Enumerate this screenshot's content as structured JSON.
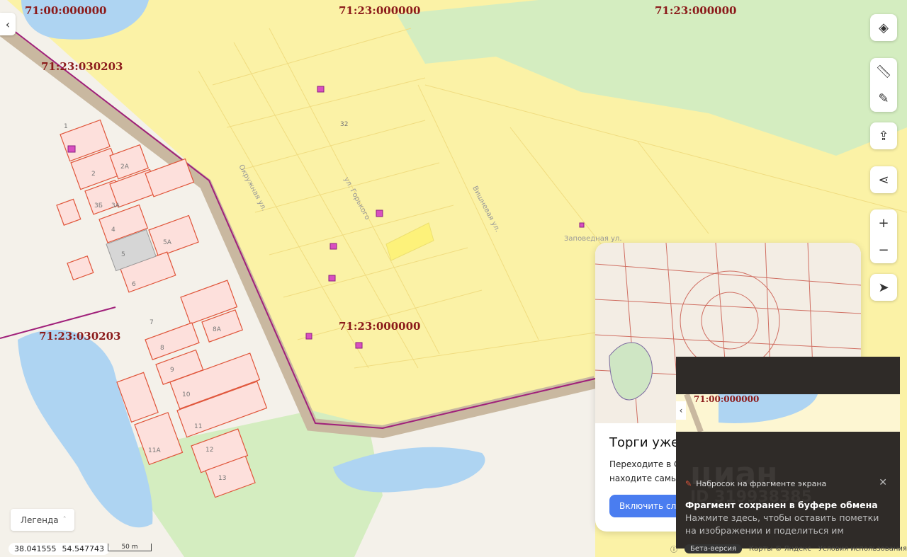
{
  "cadastral_labels": [
    "71:00:000000",
    "71:23:000000",
    "71:23:000000",
    "71:23:030203",
    "71:23:000000",
    "71:23:030203"
  ],
  "parcel_numbers": [
    "1",
    "2",
    "2А",
    "3Б",
    "3А",
    "4",
    "5",
    "5А",
    "6",
    "7",
    "8",
    "8А",
    "9",
    "10",
    "11",
    "11А",
    "12",
    "13",
    "32"
  ],
  "streets": [
    "Окружная ул.",
    "ул. Горького",
    "Вишневая ул.",
    "Заповедная ул."
  ],
  "controls": {
    "layers": "layers-icon",
    "ruler": "ruler-icon",
    "edit": "edit-icon",
    "upload": "upload-icon",
    "share": "share-icon",
    "zoom_in": "+",
    "zoom_out": "−",
    "locate": "locate-icon"
  },
  "legend": {
    "label": "Легенда"
  },
  "coords": {
    "lon": "38.041555",
    "lat": "54.547743"
  },
  "scale": "50 m",
  "promo": {
    "title": "Торги уже н",
    "text1": "Переходите в Сл",
    "text2": "находите самые",
    "button": "Включить сло"
  },
  "notification": {
    "screenshot_label": "71:00:000000",
    "watermark": "циан",
    "watermark_id": "ID 319938385",
    "app": "Набросок на фрагменте экрана",
    "title": "Фрагмент сохранен в буфере обмена",
    "desc": "Нажмите здесь, чтобы оставить пометки на изображении и поделиться им"
  },
  "footer": {
    "beta": "Бета-версия",
    "copyright": "Карты © Яндекс",
    "terms": "Условия использования"
  },
  "colors": {
    "yellow": "#fbf2a6",
    "parcel_fill": "#fde0dc",
    "parcel_stroke": "#e0553a",
    "road": "#c9b8a0",
    "boundary": "#a0207a",
    "water": "#aed4f2",
    "green": "#d4edc0"
  }
}
